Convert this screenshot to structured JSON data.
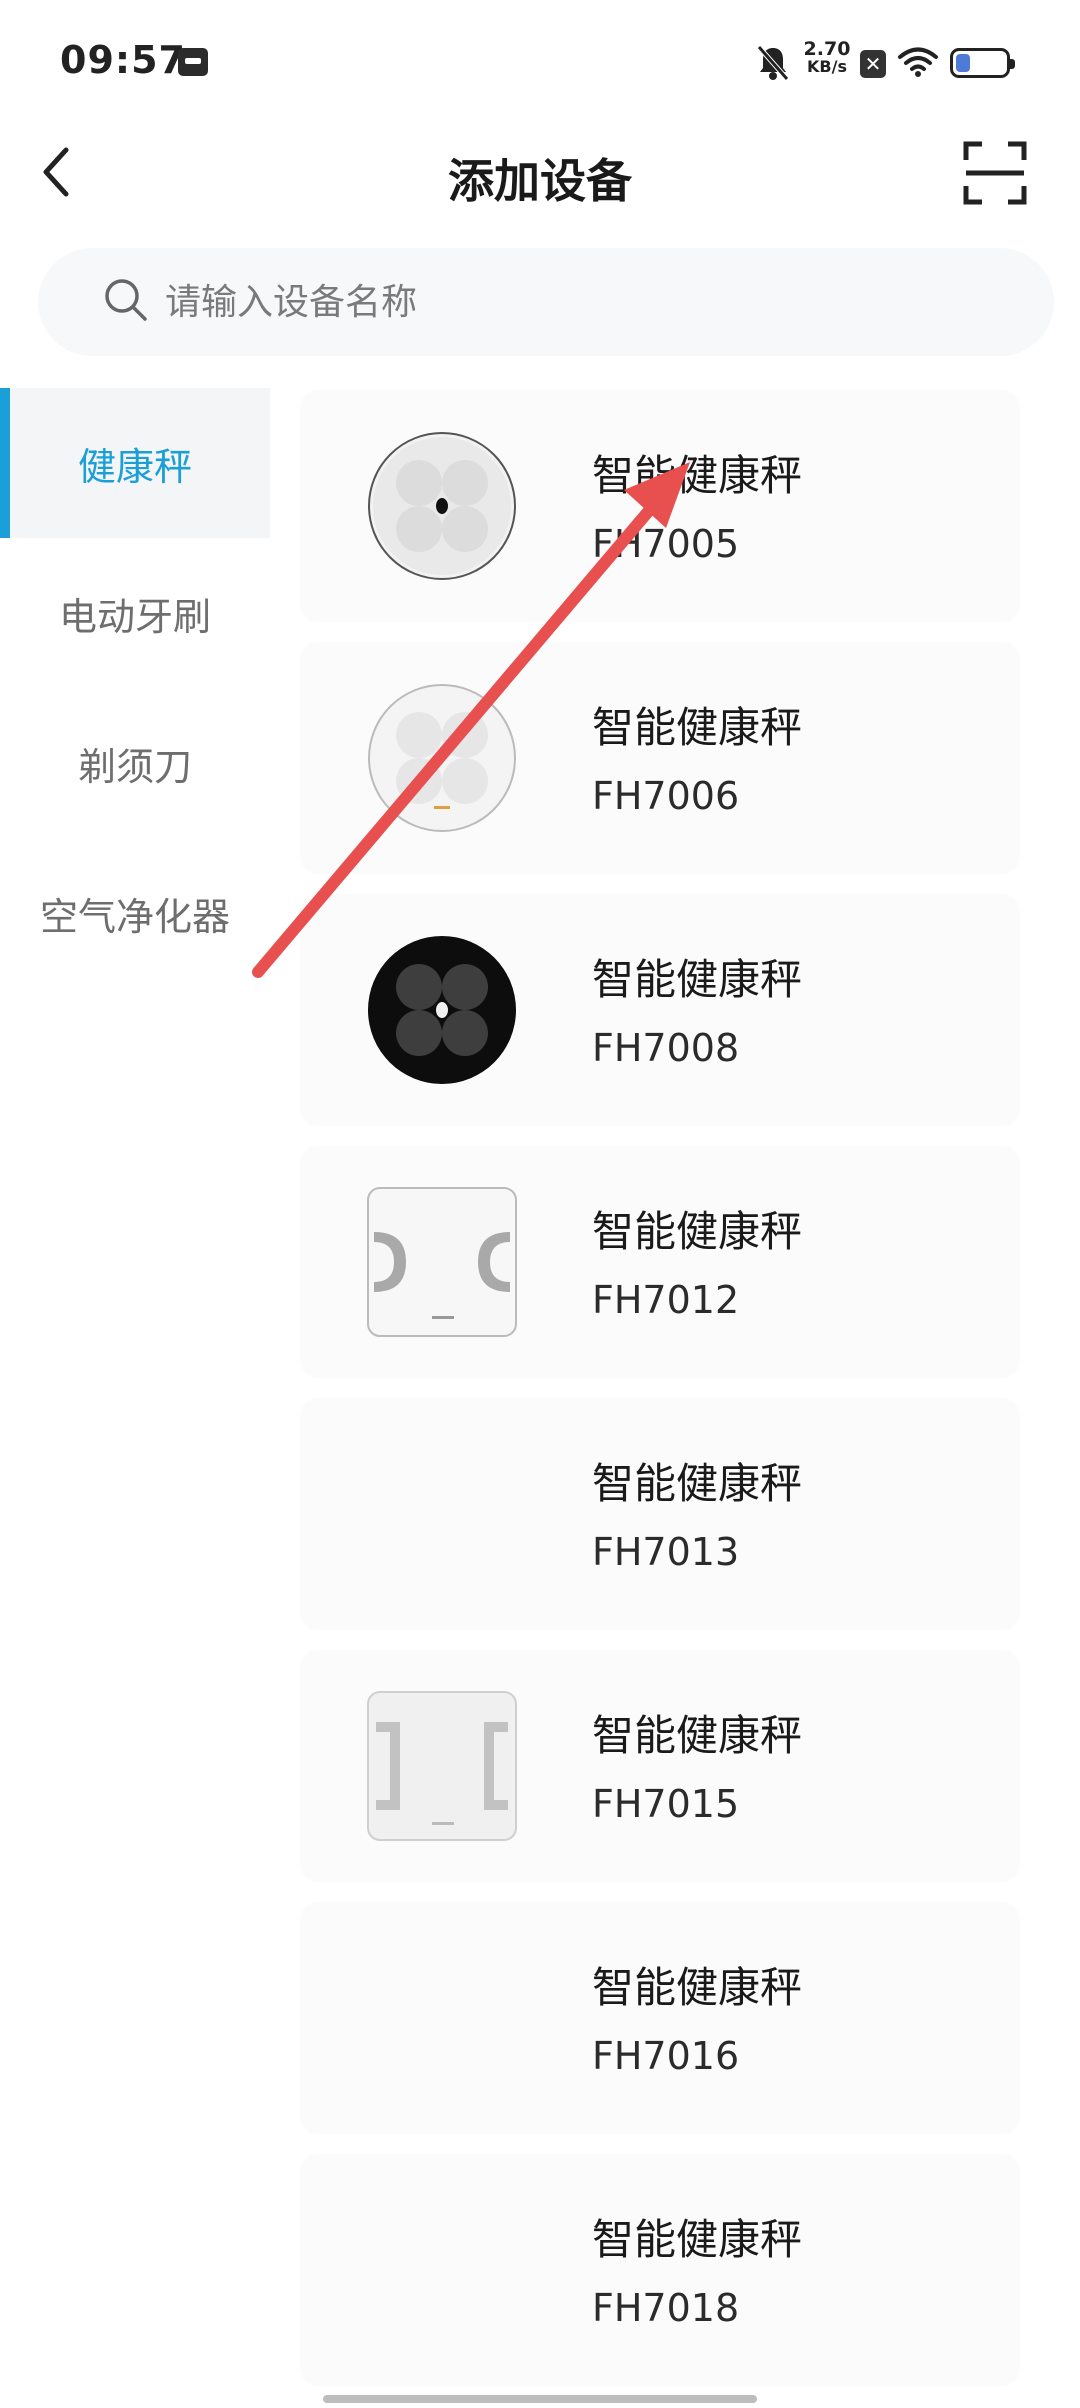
{
  "status_bar": {
    "time": "09:57",
    "net_speed_value": "2.70",
    "net_speed_unit": "KB/s",
    "icons": [
      "app-notification-icon",
      "bell-off-icon",
      "sim-disabled-icon",
      "wifi-icon",
      "battery-icon"
    ]
  },
  "header": {
    "title": "添加设备",
    "back_icon": "chevron-left-icon",
    "scan_icon": "scan-icon"
  },
  "search": {
    "placeholder": "请输入设备名称",
    "value": ""
  },
  "sidebar": {
    "items": [
      {
        "label": "健康秤",
        "active": true
      },
      {
        "label": "电动牙刷",
        "active": false
      },
      {
        "label": "剃须刀",
        "active": false
      },
      {
        "label": "空气净化器",
        "active": false
      }
    ]
  },
  "devices": [
    {
      "name": "智能健康秤",
      "model": "FH7005",
      "image": "white-round-scale"
    },
    {
      "name": "智能健康秤",
      "model": "FH7006",
      "image": "white-round-scale"
    },
    {
      "name": "智能健康秤",
      "model": "FH7008",
      "image": "black-round-scale"
    },
    {
      "name": "智能健康秤",
      "model": "FH7012",
      "image": "white-square-scale"
    },
    {
      "name": "智能健康秤",
      "model": "FH7013",
      "image": "none"
    },
    {
      "name": "智能健康秤",
      "model": "FH7015",
      "image": "white-square-scale"
    },
    {
      "name": "智能健康秤",
      "model": "FH7016",
      "image": "none"
    },
    {
      "name": "智能健康秤",
      "model": "FH7018",
      "image": "none"
    }
  ],
  "colors": {
    "accent": "#1a9fd8",
    "annotation_arrow": "#e8504f",
    "card_bg": "#fbfbfc"
  }
}
